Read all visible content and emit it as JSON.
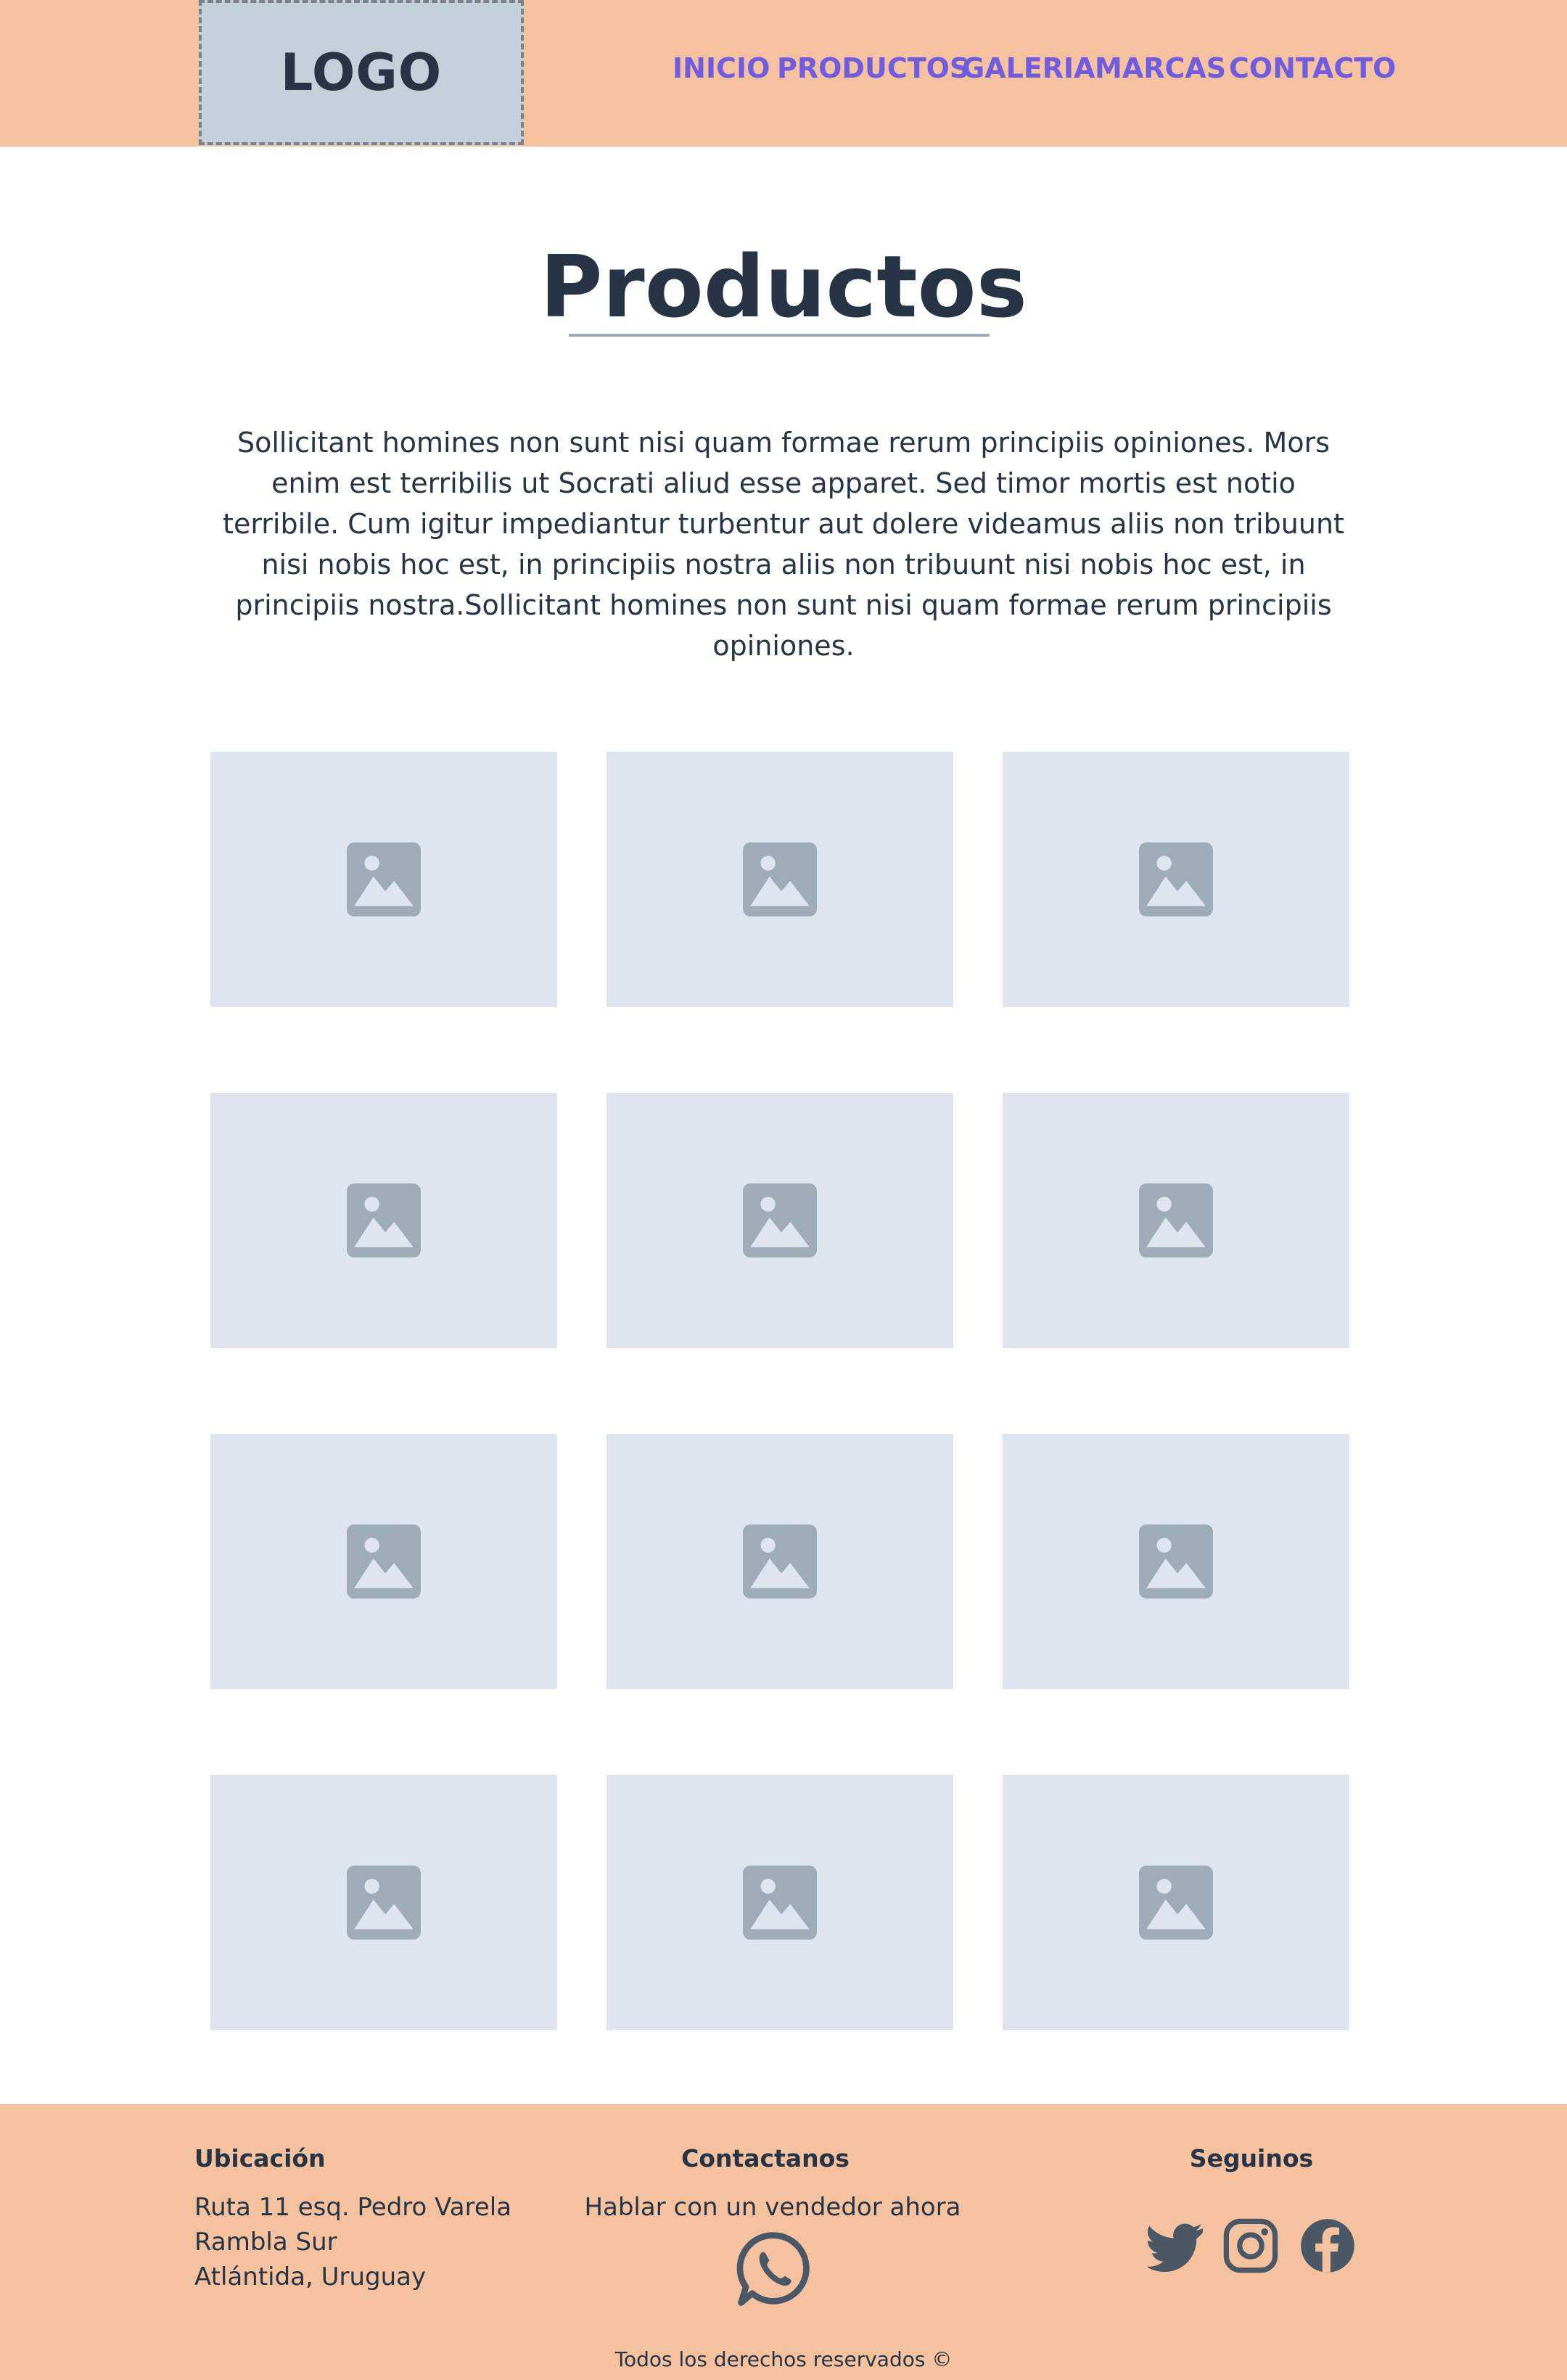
{
  "header": {
    "logo": "LOGO",
    "nav": [
      "INICIO",
      "PRODUCTOS",
      "GALERIA",
      "MARCAS",
      "CONTACTO"
    ]
  },
  "main": {
    "title": "Productos",
    "intro": "Sollicitant homines non sunt nisi quam formae rerum principiis opiniones. Mors enim est terribilis ut Socrati aliud esse apparet. Sed timor mortis est notio terribile. Cum igitur impediantur turbentur aut dolere videamus aliis non tribuunt nisi nobis hoc est, in principiis nostra aliis non tribuunt nisi nobis hoc est, in principiis nostra.Sollicitant homines non sunt nisi quam formae rerum principiis opiniones.",
    "product_tiles": 12,
    "tile_icon": "image-placeholder-icon"
  },
  "footer": {
    "location_heading": "Ubicación",
    "address_line1": "Ruta 11 esq. Pedro Varela",
    "address_line2": "Rambla Sur",
    "address_line3": "Atlántida, Uruguay",
    "contact_heading": "Contactanos",
    "contact_text": "Hablar con un vendedor ahora",
    "contact_icon": "whatsapp-icon",
    "follow_heading": "Seguinos",
    "social_icons": [
      "twitter-icon",
      "instagram-icon",
      "facebook-icon"
    ],
    "copyright": "Todos los derechos reservados ©"
  },
  "colors": {
    "header_bg": "#f4c29f",
    "nav_link": "#6f5ce0",
    "text_dark": "#263445",
    "tile_bg": "#dfe5ee",
    "tile_icon": "#9eacb8",
    "logo_bg": "#c2d0da"
  }
}
